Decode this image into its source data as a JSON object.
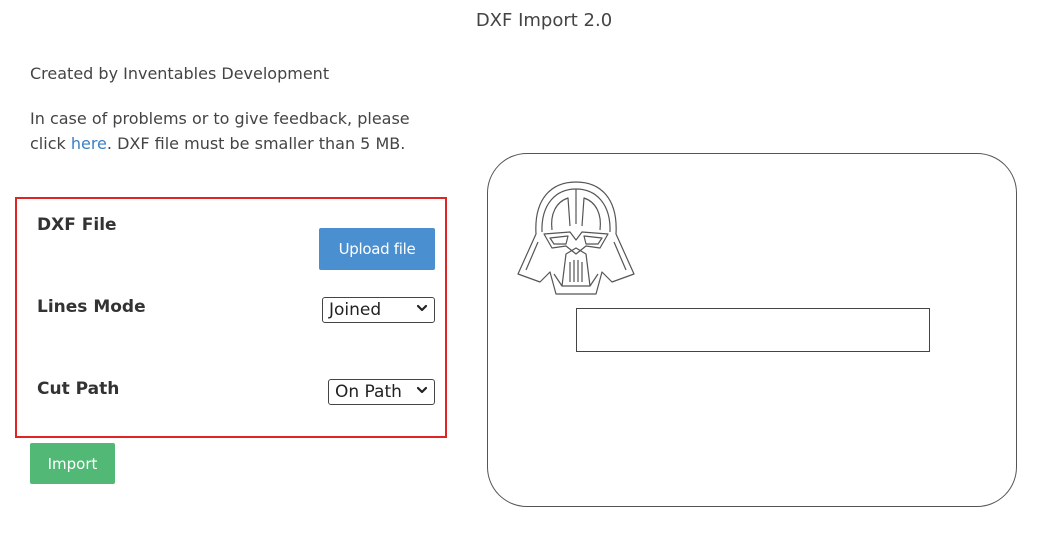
{
  "header": {
    "title": "DXF Import 2.0"
  },
  "info": {
    "created_by": "Created by Inventables Development",
    "feedback_before": "In case of problems or to give feedback, please click ",
    "feedback_link": "here",
    "feedback_after": ". DXF file must be smaller than 5 MB."
  },
  "options": {
    "dxf_file_label": "DXF File",
    "upload_button_label": "Upload file",
    "lines_mode_label": "Lines Mode",
    "lines_mode_value": "Joined",
    "cut_path_label": "Cut Path",
    "cut_path_value": "On Path"
  },
  "actions": {
    "import_label": "Import"
  },
  "preview": {
    "icon": "darth-vader-helmet-icon"
  },
  "colors": {
    "upload_button": "#4a8fd0",
    "import_button": "#52b875",
    "highlight_border": "#e02424",
    "link": "#3a7fc4"
  }
}
